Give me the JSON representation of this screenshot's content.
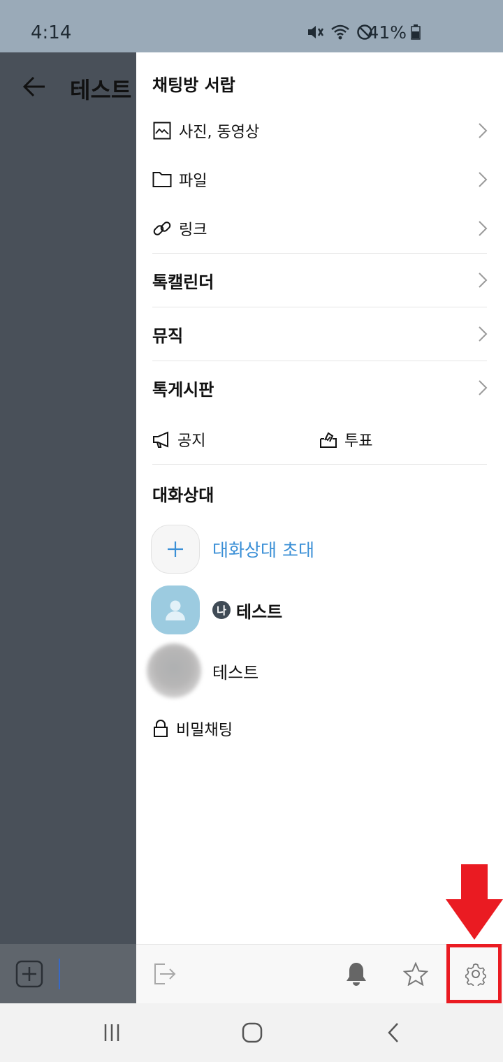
{
  "status_bar": {
    "time": "4:14",
    "battery": "41%"
  },
  "background_chat": {
    "title": "테스트"
  },
  "drawer": {
    "section_storage_title": "채팅방 서랍",
    "storage_items": [
      {
        "label": "사진, 동영상",
        "icon": "image-icon"
      },
      {
        "label": "파일",
        "icon": "folder-icon"
      },
      {
        "label": "링크",
        "icon": "link-icon"
      }
    ],
    "menu_items": [
      {
        "label": "톡캘린더"
      },
      {
        "label": "뮤직"
      },
      {
        "label": "톡게시판"
      }
    ],
    "notice_label": "공지",
    "poll_label": "투표",
    "section_members_title": "대화상대",
    "invite_label": "대화상대 초대",
    "me_badge": "나",
    "members": [
      {
        "name": "테스트"
      },
      {
        "name": "테스트"
      }
    ],
    "secret_chat_label": "비밀채팅"
  },
  "colors": {
    "accent_blue": "#3a8fd6",
    "highlight_red": "#ea1b22",
    "dim_overlay": "#495059"
  }
}
